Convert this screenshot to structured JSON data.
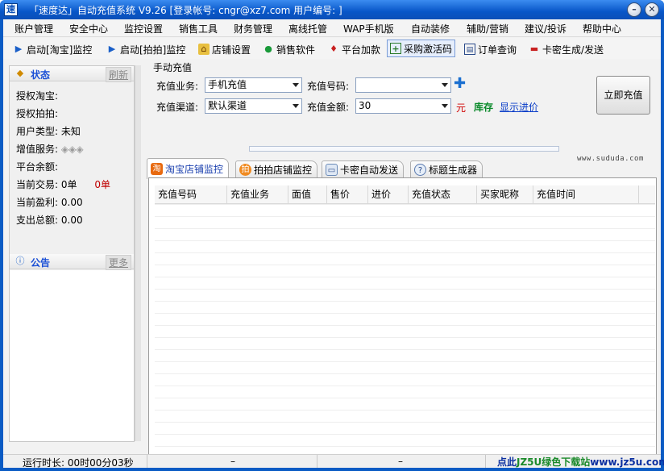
{
  "window": {
    "title": "「速度达」自动充值系统 V9.26 [登录帐号: cngr@xz7.com 用户编号: ]",
    "icon_char": "速",
    "minimize_char": "–",
    "close_char": "✕"
  },
  "menu": [
    "账户管理",
    "安全中心",
    "监控设置",
    "销售工具",
    "财务管理",
    "离线托管",
    "WAP手机版",
    "自动装修",
    "辅助/营销",
    "建议/投诉",
    "帮助中心"
  ],
  "toolbar": [
    {
      "label": "启动[淘宝]监控",
      "icon": "play-icon"
    },
    {
      "label": "启动[拍拍]监控",
      "icon": "play-icon"
    },
    {
      "label": "店铺设置",
      "icon": "shop-icon"
    },
    {
      "label": "销售软件",
      "icon": "users-icon"
    },
    {
      "label": "平台加款",
      "icon": "gift-icon"
    },
    {
      "label": "采购激活码",
      "icon": "add-code-icon"
    },
    {
      "label": "订单查询",
      "icon": "chart-icon"
    },
    {
      "label": "卡密生成/发送",
      "icon": "card-icon"
    }
  ],
  "status_panel": {
    "title": "状态",
    "refresh": "刷新",
    "rows": [
      {
        "label": "授权淘宝:",
        "value": ""
      },
      {
        "label": "授权拍拍:",
        "value": ""
      },
      {
        "label": "用户类型:",
        "value": "未知"
      },
      {
        "label": "增值服务:",
        "value": ""
      },
      {
        "label": "平台余额:",
        "value": ""
      },
      {
        "label": "当前交易:",
        "value": "0单",
        "extra": "0单"
      },
      {
        "label": "当前盈利:",
        "value": "0.00"
      },
      {
        "label": "支出总额:",
        "value": "0.00"
      }
    ]
  },
  "notice_panel": {
    "title": "公告",
    "more": "更多"
  },
  "recharge": {
    "title": "手动充值",
    "service_label": "充值业务:",
    "service_value": "手机充值",
    "number_label": "充值号码:",
    "number_value": "",
    "channel_label": "充值渠道:",
    "channel_value": "默认渠道",
    "amount_label": "充值金额:",
    "amount_value": "30",
    "unit": "元",
    "stock": "库存",
    "show_price": "显示进价",
    "submit": "立即充值"
  },
  "watermark": "www.sududa.com",
  "tabs": [
    {
      "label": "淘宝店铺监控",
      "icon": "taobao-icon",
      "active": true
    },
    {
      "label": "拍拍店铺监控",
      "icon": "paipai-icon",
      "active": false
    },
    {
      "label": "卡密自动发送",
      "icon": "card-send-icon",
      "active": false
    },
    {
      "label": "标题生成器",
      "icon": "help-icon",
      "active": false
    }
  ],
  "table": {
    "columns": [
      "充值号码",
      "充值业务",
      "面值",
      "售价",
      "进价",
      "充值状态",
      "买家昵称",
      "充值时间"
    ],
    "rows": []
  },
  "statusbar": {
    "runtime": "运行时长:  00时00分03秒",
    "cell2": "–",
    "cell3": "–",
    "cell4": "–",
    "brand_a": "点此",
    "brand_b": "JZ5U绿色下载站",
    "brand_c": "www.jz5u.com"
  }
}
